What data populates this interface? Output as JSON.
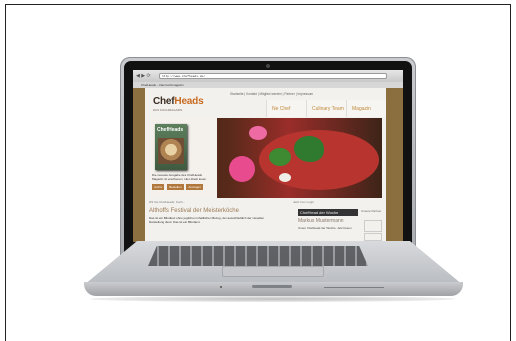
{
  "browser": {
    "url": "http://www.chefheads.de/",
    "tab": "ChefHeads – Das Kochmagazin"
  },
  "site": {
    "logo_chef": "Chef",
    "logo_heads": "Heads",
    "logo_sub": "DAS KOCHMAGAZIN",
    "top_links": "Startseite  |  Kontakt  |  Mitglied werden  |  Partner  |  Impressum",
    "menu": [
      "Ne Chef",
      "Culinary Team",
      "Magazin"
    ],
    "hero_text": "Die neueste Ausgabe des ChefHeads Magazin ist erschienen. Hier direkt lesen",
    "hero_buttons": [
      "Archiv",
      "Bestellen",
      "Anzeigen"
    ],
    "book_title": "ChefHeads",
    "foot_left": "Wir bei ChefHeads: Koch... ",
    "foot_right": "Jetzt zum Login",
    "festival_title": "Althoffs Festival der Meisterköche",
    "festival_text": "Das ist ein Blindtext ohne jeglichen inhaltlichen Bezug, der ausschließlich der visuellen Darstellung dient. Das ist ein Blindtext.",
    "chef_week_label": "ChefHead der Woche",
    "chef_name": "Markus Mustermann",
    "chef_text": "Unser ChefHead der Woche. Jetzt lesen",
    "partner_label": "Unsere Partner"
  }
}
